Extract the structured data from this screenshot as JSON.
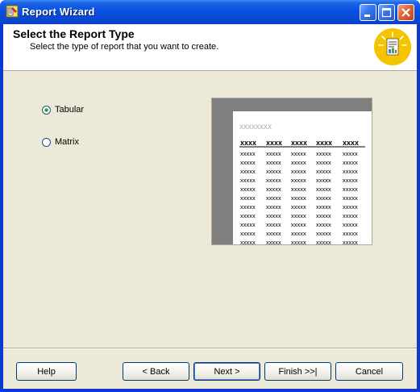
{
  "window": {
    "title": "Report Wizard"
  },
  "header": {
    "title": "Select the Report Type",
    "subtitle": "Select the type of report that you want to create."
  },
  "options": [
    {
      "label": "Tabular",
      "selected": true
    },
    {
      "label": "Matrix",
      "selected": false
    }
  ],
  "preview": {
    "placeholder_title": "xxxxxxxx",
    "header_cells": [
      "xxxx",
      "xxxx",
      "xxxx",
      "xxxx",
      "xxxx"
    ],
    "row_cell": "xxxxx",
    "row_count": 11
  },
  "buttons": {
    "help": "Help",
    "back": "< Back",
    "next": "Next >",
    "finish": "Finish >>|",
    "cancel": "Cancel"
  },
  "colors": {
    "titlebar": "#0a53e2",
    "dialog_bg": "#ece9d8",
    "preview_frame": "#7f7f7f",
    "header_icon": "#f5c400"
  }
}
